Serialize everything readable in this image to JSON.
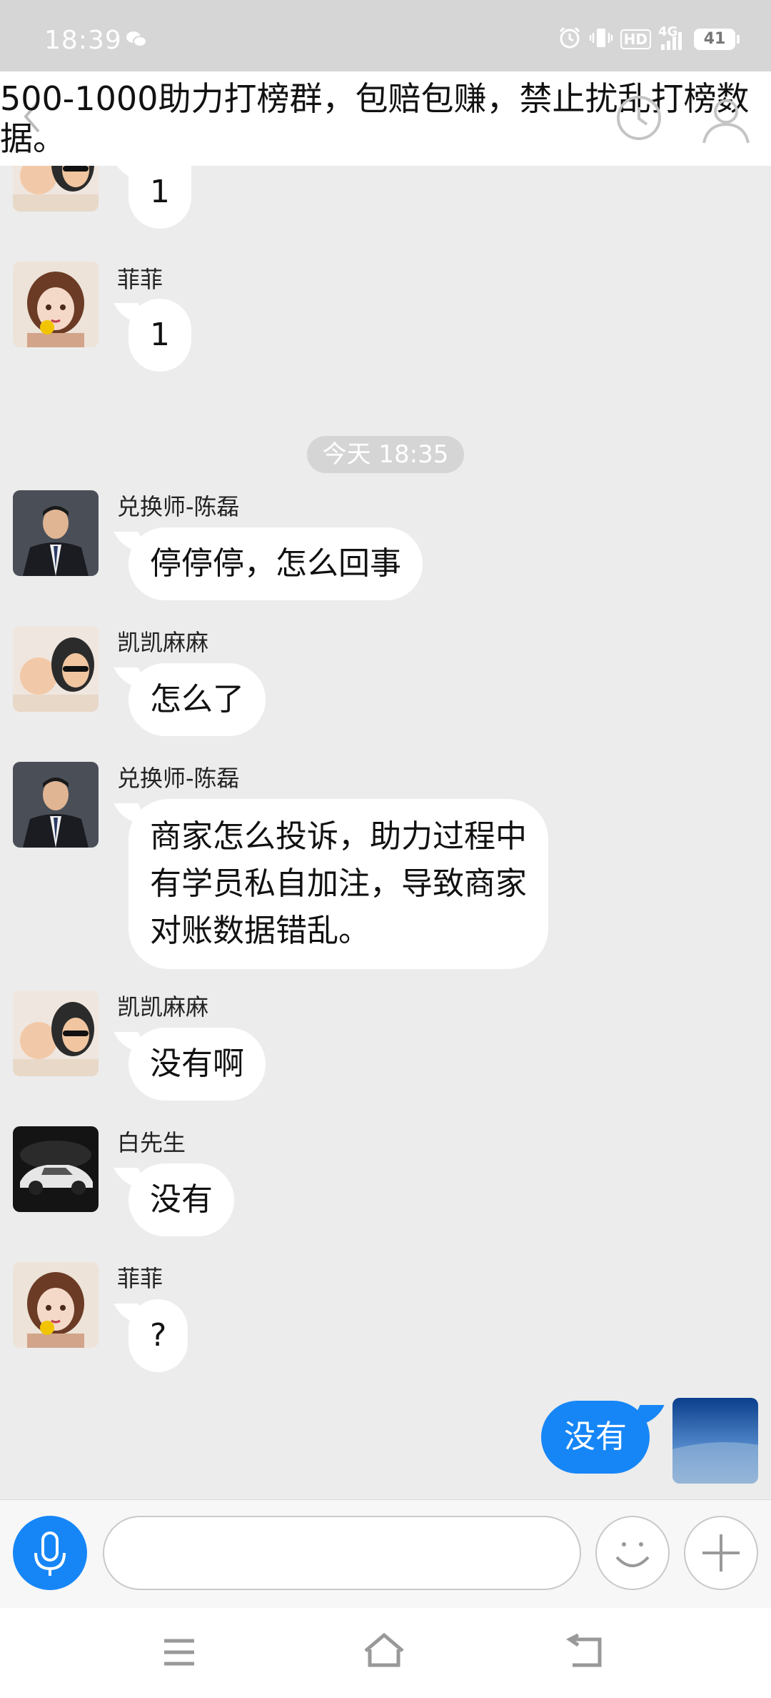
{
  "status_bar": {
    "time": "18:39",
    "battery": "41",
    "hd": "HD",
    "network": "4G"
  },
  "header": {
    "title": "500-1000助力打榜群，包赔包赚，禁止扰乱打榜数据。"
  },
  "time_divider": "今天 18:35",
  "messages": [
    {
      "sender": "",
      "text": "1",
      "avatar": "kaikai-avatar"
    },
    {
      "sender": "菲菲",
      "text": "1",
      "avatar": "feifei-avatar"
    },
    {
      "sender": "兑换师-陈磊",
      "text": "停停停，怎么回事",
      "avatar": "chenlei-avatar"
    },
    {
      "sender": "凯凯麻麻",
      "text": "怎么了",
      "avatar": "kaikai-avatar"
    },
    {
      "sender": "兑换师-陈磊",
      "text": "商家怎么投诉，助力过程中有学员私自加注，导致商家对账数据错乱。",
      "lines": [
        "商家怎么投诉，助力过程中",
        "有学员私自加注，导致商家",
        "对账数据错乱。"
      ],
      "avatar": "chenlei-avatar"
    },
    {
      "sender": "凯凯麻麻",
      "text": "没有啊",
      "avatar": "kaikai-avatar"
    },
    {
      "sender": "白先生",
      "text": "没有",
      "avatar": "car-avatar"
    },
    {
      "sender": "菲菲",
      "text": "?",
      "avatar": "feifei-avatar"
    }
  ],
  "my_message": {
    "text": "没有",
    "avatar": "sky-avatar"
  },
  "colors": {
    "accent": "#1686f7",
    "background": "#ececec"
  }
}
